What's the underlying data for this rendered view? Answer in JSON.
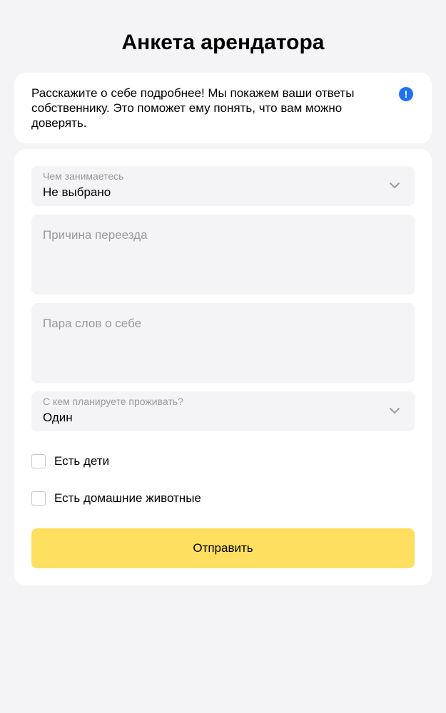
{
  "page": {
    "title": "Анкета арендатора"
  },
  "info": {
    "text": "Расскажите о себе подробнее! Мы покажем ваши ответы собственнику. Это поможет ему понять, что вам можно доверять.",
    "icon": "exclamation-icon",
    "icon_glyph": "!",
    "icon_color": "#1f72f2"
  },
  "form": {
    "occupation": {
      "label": "Чем занимаетесь",
      "value": "Не выбрано"
    },
    "relocation_reason": {
      "placeholder": "Причина переезда",
      "value": ""
    },
    "about": {
      "placeholder": "Пара слов о себе",
      "value": ""
    },
    "cohabitants": {
      "label": "С кем планируете проживать?",
      "value": "Один"
    },
    "has_children": {
      "label": "Есть дети",
      "checked": false
    },
    "has_pets": {
      "label": "Есть домашние животные",
      "checked": false
    },
    "submit_label": "Отправить"
  },
  "colors": {
    "background": "#f4f4f6",
    "accent_button": "#ffdf60",
    "info_icon": "#1f72f2"
  }
}
